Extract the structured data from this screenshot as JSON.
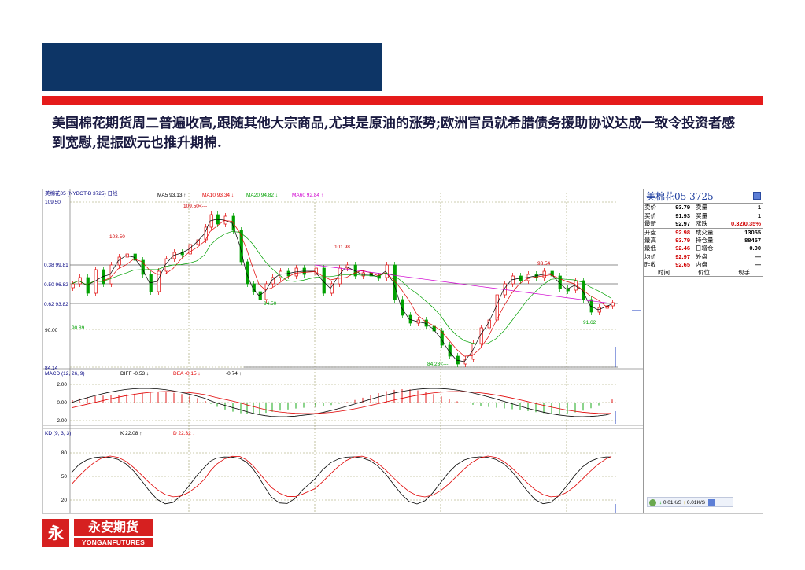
{
  "headline": "美国棉花期货周二普遍收高,跟随其他大宗商品,尤其是原油的涨势;欧洲官员就希腊债务援助协议达成一致令投资者感到宽慰,提振欧元也推升期棉.",
  "chart": {
    "title": "美棉花05 (NYBOT-B 3725) 日线",
    "ma5": "MA5 93.13 ↑",
    "ma10": "MA10 93.34 ↓",
    "ma20": "MA20 94.82 ↓",
    "ma60": "MA60 92.84 ↑",
    "y_labels": [
      "109.50",
      "0.38 99.81",
      "0.50 96.82",
      "0.62 93.82",
      "90.00",
      "84.14"
    ],
    "annotations": [
      "109.50<---",
      "103.50",
      "101.98",
      "93.54",
      "94.50",
      "91.62",
      "90.89",
      "84.23<---"
    ],
    "macd_title": "MACD (12, 26, 9)",
    "macd_diff": "DIFF -0.53 ↓",
    "macd_dea": "DEA -0.15 ↓",
    "macd_val": "-0.74 ↑",
    "macd_y": [
      "2.00",
      "0.00",
      "-2.00"
    ],
    "kd_title": "KD (9, 3, 3)",
    "kd_k": "K 22.08 ↑",
    "kd_d": "D 22.32 ↓",
    "kd_y": [
      "80",
      "50",
      "20"
    ]
  },
  "chart_data": {
    "type": "line",
    "title": "美棉花05 (NYBOT-B 3725) 日线",
    "ylim": [
      84.14,
      109.5
    ],
    "series": [
      {
        "name": "MA5",
        "last": 93.13
      },
      {
        "name": "MA10",
        "last": 93.34
      },
      {
        "name": "MA20",
        "last": 94.82
      },
      {
        "name": "MA60",
        "last": 92.84
      }
    ],
    "macd": {
      "diff": -0.53,
      "dea": -0.15,
      "macd": -0.74,
      "ylim": [
        -2,
        2
      ]
    },
    "kd": {
      "k": 22.08,
      "d": 22.32,
      "ylim": [
        0,
        100
      ]
    }
  },
  "quote": {
    "title": "美棉花05 3725",
    "rows_left": [
      {
        "label": "卖价",
        "value": "93.79",
        "label2": "卖量",
        "value2": "1"
      },
      {
        "label": "买价",
        "value": "91.93",
        "label2": "买量",
        "value2": "1"
      },
      {
        "label": "最新",
        "value": "92.97",
        "label2": "涨跌",
        "value2": "0.32/0.35%"
      }
    ],
    "rows_stats": [
      {
        "label": "开盘",
        "value": "92.98",
        "label2": "成交量",
        "value2": "13055"
      },
      {
        "label": "最高",
        "value": "93.79",
        "label2": "持仓量",
        "value2": "88457"
      },
      {
        "label": "最低",
        "value": "92.46",
        "label2": "日增仓",
        "value2": "0.00"
      },
      {
        "label": "均价",
        "value": "92.97",
        "label2": "外盘",
        "value2": "—"
      },
      {
        "label": "昨收",
        "value": "92.65",
        "label2": "内盘",
        "value2": "—"
      }
    ],
    "minihead": [
      "时间",
      "价位",
      "现手"
    ],
    "bottom_down": "0.01K/S",
    "bottom_up": "0.01K/S"
  },
  "logo": {
    "mark": "永",
    "cn": "永安期货",
    "en": "YONGANFUTURES"
  },
  "colors": {
    "banner": "#0d3566",
    "red": "#e51b1b",
    "up": "#d00000",
    "down": "#00a000"
  }
}
